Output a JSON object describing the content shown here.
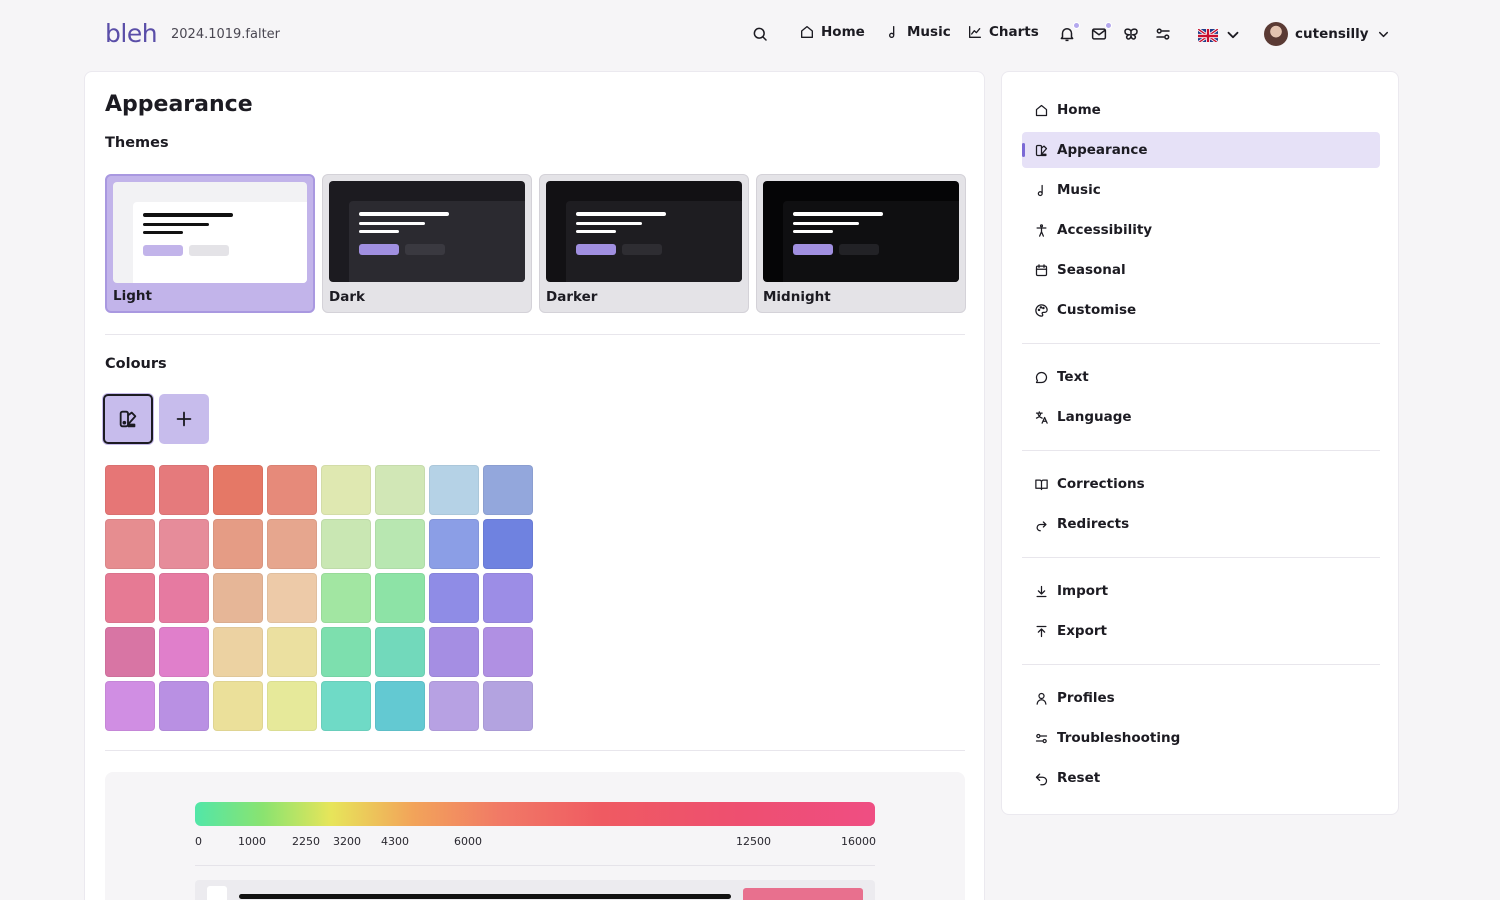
{
  "header": {
    "brand": "bleh",
    "version": "2024.1019.falter",
    "nav": [
      {
        "label": "Home",
        "icon": "home-icon"
      },
      {
        "label": "Music",
        "icon": "music-note-icon"
      },
      {
        "label": "Charts",
        "icon": "chart-line-icon"
      }
    ],
    "icons": [
      "search-icon",
      "bell-icon",
      "mail-icon",
      "butterfly-icon",
      "sliders-icon",
      "uk-flag-icon",
      "chevron-down-icon"
    ],
    "username": "cutensilly"
  },
  "main": {
    "title": "Appearance",
    "themes_title": "Themes",
    "themes": [
      {
        "label": "Light",
        "selected": true
      },
      {
        "label": "Dark",
        "selected": false
      },
      {
        "label": "Darker",
        "selected": false
      },
      {
        "label": "Midnight",
        "selected": false
      }
    ],
    "colours_title": "Colours",
    "swatch_colors": [
      "#e67676",
      "#e57a7c",
      "#e57866",
      "#e68a7a",
      "#dfe8b1",
      "#d1e7b6",
      "#b5d2e6",
      "#93a7dc",
      "#e68d90",
      "#e68c9a",
      "#e59c85",
      "#e6a68e",
      "#c9e7b3",
      "#b8e7b1",
      "#8b9ee6",
      "#6f82e0",
      "#e67a94",
      "#e67aa1",
      "#e6b697",
      "#edcaa8",
      "#a2e6a2",
      "#8de3a6",
      "#8f8ce6",
      "#9c8de6",
      "#d875a4",
      "#e07fcb",
      "#ecd2a2",
      "#ebe0a0",
      "#7ddfae",
      "#72d9bb",
      "#a58ee3",
      "#b090e3",
      "#d08ee3",
      "#b990e3",
      "#ebe09a",
      "#e6e99a",
      "#6fdac6",
      "#63c9d2",
      "#b7a1e3",
      "#b3a3e0"
    ],
    "scale_ticks": [
      "0",
      "1000",
      "2250",
      "3200",
      "4300",
      "6000",
      "12500",
      "16000"
    ]
  },
  "sidebar": {
    "groups": [
      [
        {
          "label": "Home",
          "icon": "home-icon",
          "active": false
        },
        {
          "label": "Appearance",
          "icon": "palette-brush-icon",
          "active": true
        },
        {
          "label": "Music",
          "icon": "music-note-icon",
          "active": false
        },
        {
          "label": "Accessibility",
          "icon": "accessibility-icon",
          "active": false
        },
        {
          "label": "Seasonal",
          "icon": "calendar-icon",
          "active": false
        },
        {
          "label": "Customise",
          "icon": "palette-icon",
          "active": false
        }
      ],
      [
        {
          "label": "Text",
          "icon": "speech-bubble-icon",
          "active": false
        },
        {
          "label": "Language",
          "icon": "translate-icon",
          "active": false
        }
      ],
      [
        {
          "label": "Corrections",
          "icon": "book-open-icon",
          "active": false
        },
        {
          "label": "Redirects",
          "icon": "redirect-arrow-icon",
          "active": false
        }
      ],
      [
        {
          "label": "Import",
          "icon": "download-icon",
          "active": false
        },
        {
          "label": "Export",
          "icon": "upload-icon",
          "active": false
        }
      ],
      [
        {
          "label": "Profiles",
          "icon": "user-icon",
          "active": false
        },
        {
          "label": "Troubleshooting",
          "icon": "sliders-icon",
          "active": false
        },
        {
          "label": "Reset",
          "icon": "undo-icon",
          "active": false
        }
      ]
    ]
  }
}
